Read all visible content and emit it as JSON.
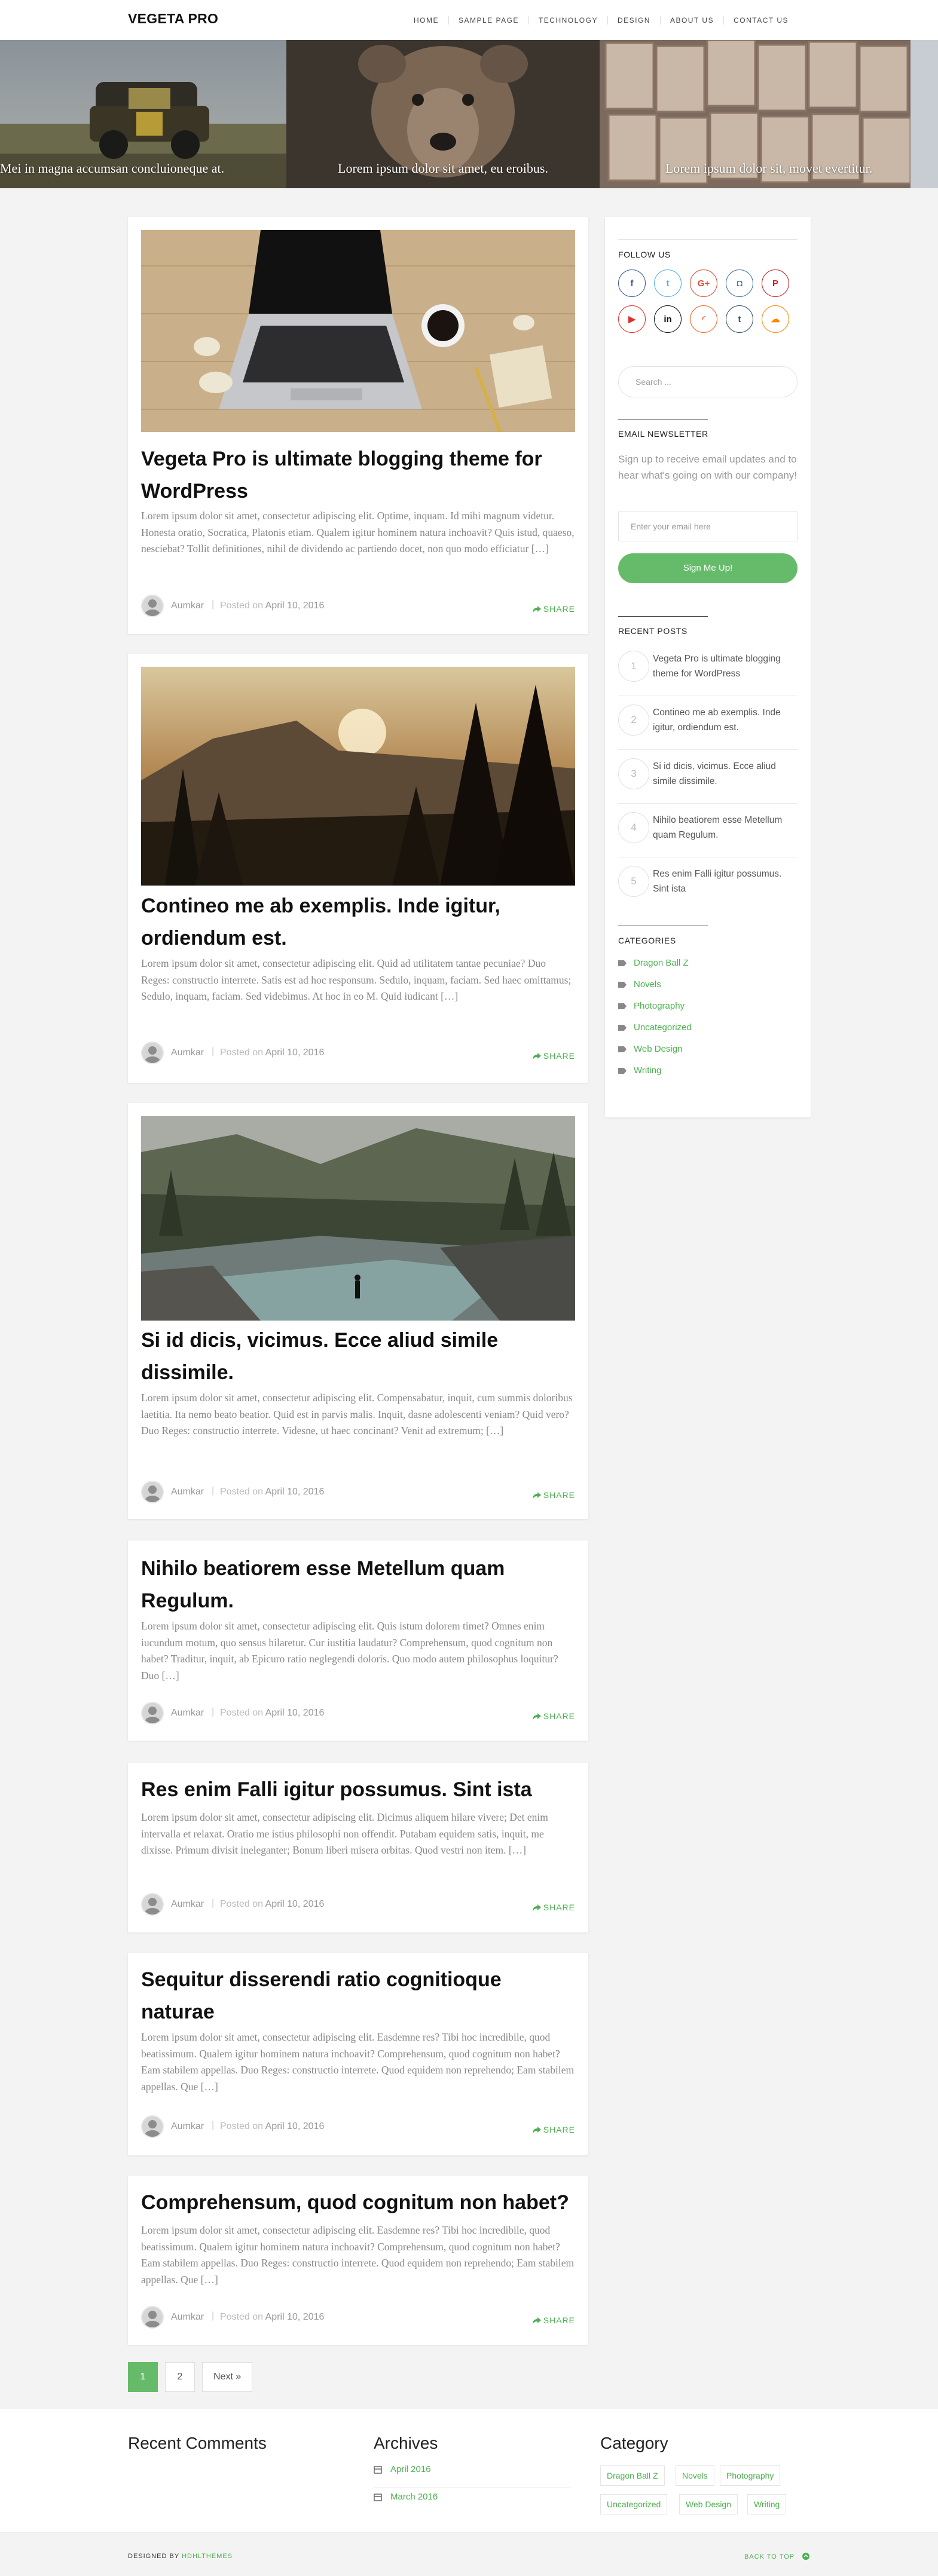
{
  "header": {
    "logo": "VEGETA PRO",
    "nav": [
      "HOME",
      "SAMPLE PAGE",
      "TECHNOLOGY",
      "DESIGN",
      "ABOUT US",
      "CONTACT US"
    ]
  },
  "slider": [
    {
      "caption": "Mei in magna accumsan concluioneque at."
    },
    {
      "caption": "Lorem ipsum dolor sit amet, eu eroibus."
    },
    {
      "caption": "Lorem ipsum dolor sit, movet evertitur."
    }
  ],
  "posts": [
    {
      "title": "Vegeta Pro is ultimate blogging theme for WordPress",
      "excerpt": "Lorem ipsum dolor sit amet, consectetur adipiscing elit. Optime, inquam. Id mihi magnum videtur. Honesta oratio, Socratica, Platonis etiam. Qualem igitur hominem natura inchoavit? Quis istud, quaeso, nesciebat? Tollit definitiones, nihil de dividendo ac partiendo docet, non quo modo efficiatur […]",
      "author": "Aumkar",
      "posted_label": "Posted on",
      "date": "April 10, 2016",
      "share": "SHARE"
    },
    {
      "title": "Contineo me ab exemplis. Inde igitur, ordiendum est.",
      "excerpt": "Lorem ipsum dolor sit amet, consectetur adipiscing elit. Quid ad utilitatem tantae pecuniae? Duo Reges: constructio interrete. Satis est ad hoc responsum. Sedulo, inquam, faciam. Sed haec omittamus; Sedulo, inquam, faciam. Sed videbimus. At hoc in eo M. Quid iudicant […]",
      "author": "Aumkar",
      "posted_label": "Posted on",
      "date": "April 10, 2016",
      "share": "SHARE"
    },
    {
      "title": "Si id dicis, vicimus. Ecce aliud simile dissimile.",
      "excerpt": "Lorem ipsum dolor sit amet, consectetur adipiscing elit. Compensabatur, inquit, cum summis doloribus laetitia. Ita nemo beato beatior. Quid est in parvis malis. Inquit, dasne adolescenti veniam? Quid vero? Duo Reges: constructio interrete. Videsne, ut haec concinant? Venit ad extremum; […]",
      "author": "Aumkar",
      "posted_label": "Posted on",
      "date": "April 10, 2016",
      "share": "SHARE"
    },
    {
      "title": "Nihilo beatiorem esse Metellum quam Regulum.",
      "excerpt": "Lorem ipsum dolor sit amet, consectetur adipiscing elit. Quis istum dolorem timet? Omnes enim iucundum motum, quo sensus hilaretur. Cur iustitia laudatur? Comprehensum, quod cognitum non habet? Traditur, inquit, ab Epicuro ratio neglegendi doloris. Quo modo autem philosophus loquitur? Duo […]",
      "author": "Aumkar",
      "posted_label": "Posted on",
      "date": "April 10, 2016",
      "share": "SHARE"
    },
    {
      "title": "Res enim Falli igitur possumus. Sint ista",
      "excerpt": "Lorem ipsum dolor sit amet, consectetur adipiscing elit. Dicimus aliquem hilare vivere; Det enim intervalla et relaxat. Oratio me istius philosophi non offendit. Putabam equidem satis, inquit, me dixisse. Primum divisit ineleganter; Bonum liberi misera orbitas. Quod vestri non item. […]",
      "author": "Aumkar",
      "posted_label": "Posted on",
      "date": "April 10, 2016",
      "share": "SHARE"
    },
    {
      "title": "Sequitur disserendi ratio cognitioque naturae",
      "excerpt": "Lorem ipsum dolor sit amet, consectetur adipiscing elit. Easdemne res? Tibi hoc incredibile, quod beatissimum. Qualem igitur hominem natura inchoavit? Comprehensum, quod cognitum non habet? Eam stabilem appellas. Duo Reges: constructio interrete. Quod equidem non reprehendo; Eam stabilem appellas. Que […]",
      "author": "Aumkar",
      "posted_label": "Posted on",
      "date": "April 10, 2016",
      "share": "SHARE"
    },
    {
      "title": "Comprehensum, quod cognitum non habet?",
      "excerpt": "Lorem ipsum dolor sit amet, consectetur adipiscing elit. Easdemne res? Tibi hoc incredibile, quod beatissimum. Qualem igitur hominem natura inchoavit? Comprehensum, quod cognitum non habet? Eam stabilem appellas. Duo Reges: constructio interrete. Quod equidem non reprehendo; Eam stabilem appellas. Que […]",
      "author": "Aumkar",
      "posted_label": "Posted on",
      "date": "April 10, 2016",
      "share": "SHARE"
    }
  ],
  "sidebar": {
    "follow_title": "FOLLOW US",
    "social": [
      {
        "name": "facebook-icon",
        "glyph": "f",
        "color": "#3b5998"
      },
      {
        "name": "twitter-icon",
        "glyph": "t",
        "color": "#55acee"
      },
      {
        "name": "google-plus-icon",
        "glyph": "G+",
        "color": "#dd4b39"
      },
      {
        "name": "instagram-icon",
        "glyph": "◘",
        "color": "#3f729b"
      },
      {
        "name": "pinterest-icon",
        "glyph": "P",
        "color": "#cb2027"
      },
      {
        "name": "youtube-icon",
        "glyph": "▶",
        "color": "#e52d27"
      },
      {
        "name": "linkedin-icon",
        "glyph": "in",
        "color": "#111111"
      },
      {
        "name": "rss-icon",
        "glyph": "◜",
        "color": "#f26522"
      },
      {
        "name": "tumblr-icon",
        "glyph": "t",
        "color": "#32506d"
      },
      {
        "name": "soundcloud-icon",
        "glyph": "☁",
        "color": "#ff8800"
      }
    ],
    "search_placeholder": "Search ...",
    "newsletter_title": "EMAIL NEWSLETTER",
    "newsletter_text": "Sign up to receive email updates and to hear what's going on with our company!",
    "email_placeholder": "Enter your email here",
    "signup_label": "Sign Me Up!",
    "recent_title": "RECENT POSTS",
    "recent_posts": [
      {
        "num": "1",
        "title": "Vegeta Pro is ultimate blogging theme for WordPress"
      },
      {
        "num": "2",
        "title": "Contineo me ab exemplis. Inde igitur, ordiendum est."
      },
      {
        "num": "3",
        "title": "Si id dicis, vicimus. Ecce aliud simile dissimile."
      },
      {
        "num": "4",
        "title": "Nihilo beatiorem esse Metellum quam Regulum."
      },
      {
        "num": "5",
        "title": "Res enim Falli igitur possumus. Sint ista"
      }
    ],
    "categories_title": "CATEGORIES",
    "categories": [
      "Dragon Ball Z",
      "Novels",
      "Photography",
      "Uncategorized",
      "Web Design",
      "Writing"
    ]
  },
  "pagination": {
    "pages": [
      "1",
      "2"
    ],
    "next": "Next »"
  },
  "footer": {
    "comments_title": "Recent Comments",
    "archives_title": "Archives",
    "archives": [
      "April 2016",
      "March 2016"
    ],
    "category_title": "Category",
    "category_tags": [
      "Dragon Ball Z",
      "Novels",
      "Photography",
      "Uncategorized",
      "Web Design",
      "Writing"
    ],
    "designed_by_label": "DESIGNED BY",
    "designed_by_name": "HDHLTHEMES",
    "back_to_top": "BACK TO TOP"
  },
  "colors": {
    "accent": "#4CAF50",
    "button": "#66bb6a"
  }
}
